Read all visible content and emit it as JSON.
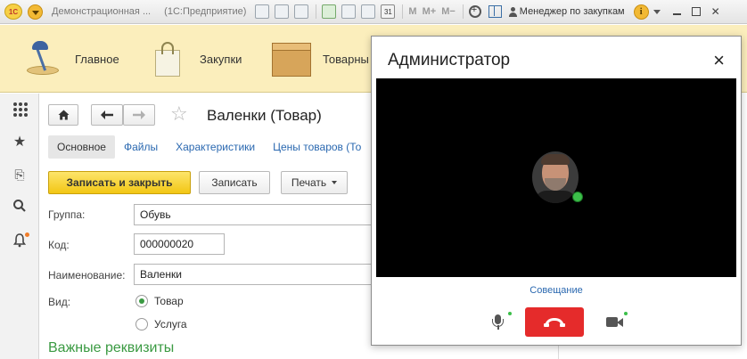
{
  "titlebar": {
    "logo": "1С",
    "app_title": "Демонстрационная ...",
    "app_subtitle": "(1С:Предприятие)",
    "m_labels": [
      "M",
      "M+",
      "M−"
    ],
    "user": "Менеджер по закупкам",
    "info": "i",
    "icons": [
      "save-icon",
      "print-icon",
      "preview-icon",
      "upload-icon",
      "mail-icon",
      "table-icon",
      "calendar-icon",
      "zoom-icon",
      "panel-icon",
      "user-icon",
      "info-icon"
    ],
    "colors": {
      "logo_yellow": "#f7d046",
      "menu_orange": "#f2b934"
    }
  },
  "sections": {
    "items": [
      {
        "label": "Главное",
        "icon": "desk-lamp-icon"
      },
      {
        "label": "Закупки",
        "icon": "shopping-bag-icon"
      },
      {
        "label": "Товарны",
        "icon": "box-icon"
      }
    ],
    "background": "#fbeebc"
  },
  "sidebar": {
    "icons": [
      "apps-grid-icon",
      "star-icon",
      "history-icon",
      "search-icon",
      "bell-icon"
    ]
  },
  "form": {
    "title": "Валенки (Товар)",
    "tabs": [
      "Основное",
      "Файлы",
      "Характеристики",
      "Цены товаров (То"
    ],
    "buttons": {
      "write_close": "Записать и закрыть",
      "write": "Записать",
      "print": "Печать"
    },
    "fields": {
      "group_label": "Группа:",
      "group_value": "Обувь",
      "code_label": "Код:",
      "code_value": "000000020",
      "name_label": "Наименование:",
      "name_value": "Валенки",
      "kind_label": "Вид:",
      "kind_options": [
        {
          "label": "Товар",
          "selected": true
        },
        {
          "label": "Услуга",
          "selected": false
        }
      ]
    },
    "section_title": "Важные реквизиты",
    "accent": "#3a9a42"
  },
  "call": {
    "title": "Администратор",
    "close": "×",
    "conference_link": "Совещание",
    "hangup_color": "#e52b2b",
    "status_color": "#3cbf4a"
  }
}
